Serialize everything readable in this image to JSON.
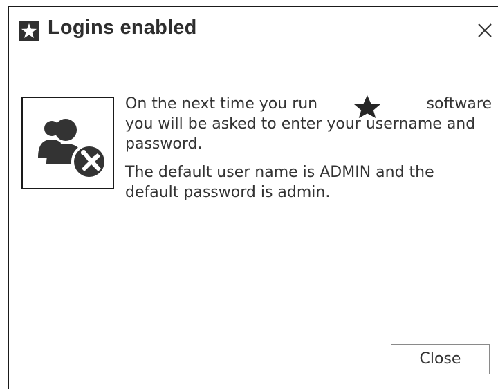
{
  "dialog": {
    "title": "Logins enabled",
    "title_icon": "star-icon",
    "close_icon": "close-icon"
  },
  "logo": {
    "icon": "users-settings-icon"
  },
  "message": {
    "line1_before": "On the next time you run",
    "brand_icon": "star-icon",
    "line1_after": "software",
    "line_rest": "you will be asked to enter your username and password.",
    "paragraph2": "The default user name is ADMIN and the default password is admin."
  },
  "buttons": {
    "close_label": "Close"
  },
  "colors": {
    "icon_dark": "#303030",
    "text": "#333333",
    "border": "#1a1a1a"
  }
}
